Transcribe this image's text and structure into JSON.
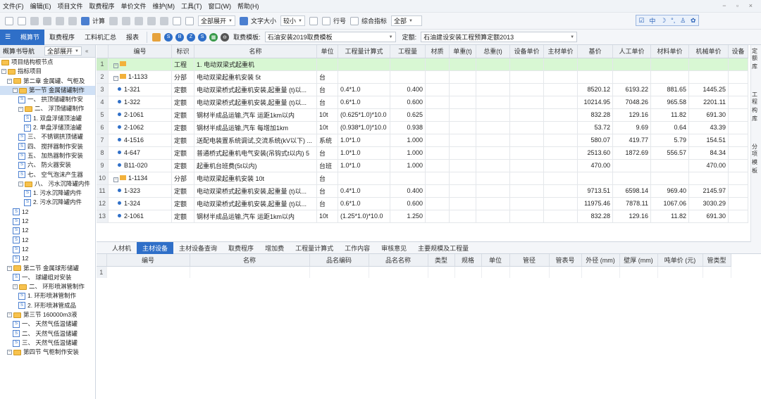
{
  "menu": [
    "文件(F)",
    "编辑(E)",
    "项目文件",
    "取费程序",
    "单价文件",
    "维护(M)",
    "工具(T)",
    "窗口(W)",
    "帮助(H)"
  ],
  "toolbar1": {
    "calc_label": "计算",
    "expand_select": "全部展开",
    "font_size_label": "文字大小",
    "font_size_value": "较小",
    "row_no_label": "行号",
    "composite_label": "综合指标",
    "composite_value": "全部"
  },
  "toolbar2": {
    "tabs": [
      "概算节",
      "取费程序",
      "工料机汇总",
      "报表"
    ],
    "fee_template_label": "取费模板:",
    "fee_template_value": "石油安装2019取费模板",
    "quota_label": "定额:",
    "quota_value": "石油建设安装工程预算定额2013"
  },
  "nav": {
    "title": "概算书导航",
    "expand": "全部展开",
    "tree": [
      {
        "level": 0,
        "icon": "folder",
        "toggle": "",
        "label": "项目结构根节点"
      },
      {
        "level": 0,
        "icon": "folder",
        "toggle": "⊟",
        "label": "指标项目"
      },
      {
        "level": 1,
        "icon": "folder",
        "toggle": "⊟",
        "label": "第二章 金属罐、气柜及"
      },
      {
        "level": 2,
        "icon": "folder",
        "toggle": "⊟",
        "label": "第一节 金属储罐制作",
        "selected": true
      },
      {
        "level": 3,
        "icon": "doc",
        "toggle": "",
        "label": "一、 拱顶储罐制作安"
      },
      {
        "level": 3,
        "icon": "folder",
        "toggle": "⊟",
        "label": "二、 浮顶储罐制作"
      },
      {
        "level": 4,
        "icon": "doc",
        "toggle": "",
        "label": "1. 双盘浮储顶油罐"
      },
      {
        "level": 4,
        "icon": "doc",
        "toggle": "",
        "label": "2. 单盘浮储顶油罐"
      },
      {
        "level": 3,
        "icon": "doc",
        "toggle": "",
        "label": "三、 不锈钢拱顶储罐"
      },
      {
        "level": 3,
        "icon": "doc",
        "toggle": "",
        "label": "四、 搅拌器制作安装"
      },
      {
        "level": 3,
        "icon": "doc",
        "toggle": "",
        "label": "五、 加热器制作安装"
      },
      {
        "level": 3,
        "icon": "doc",
        "toggle": "",
        "label": "六、 防火器安装"
      },
      {
        "level": 3,
        "icon": "doc",
        "toggle": "",
        "label": "七、 空气泡沫产生器"
      },
      {
        "level": 3,
        "icon": "folder",
        "toggle": "⊟",
        "label": "八、 污水沉降罐内件"
      },
      {
        "level": 4,
        "icon": "doc",
        "toggle": "",
        "label": "1. 污水沉降罐内件"
      },
      {
        "level": 4,
        "icon": "doc",
        "toggle": "",
        "label": "2. 污水沉降罐内件"
      },
      {
        "level": 2,
        "icon": "doc",
        "toggle": "",
        "label": "12"
      },
      {
        "level": 2,
        "icon": "doc",
        "toggle": "",
        "label": "12"
      },
      {
        "level": 2,
        "icon": "doc",
        "toggle": "",
        "label": "12"
      },
      {
        "level": 2,
        "icon": "doc",
        "toggle": "",
        "label": "12"
      },
      {
        "level": 2,
        "icon": "doc",
        "toggle": "",
        "label": "12"
      },
      {
        "level": 2,
        "icon": "doc",
        "toggle": "",
        "label": "12"
      },
      {
        "level": 1,
        "icon": "folder",
        "toggle": "⊟",
        "label": "第二节 金属球形储罐"
      },
      {
        "level": 2,
        "icon": "doc",
        "toggle": "",
        "label": "一、 球罐组对安装"
      },
      {
        "level": 2,
        "icon": "folder",
        "toggle": "⊟",
        "label": "二、 环形喷淋管制作"
      },
      {
        "level": 3,
        "icon": "doc",
        "toggle": "",
        "label": "1. 环形喷淋管制作"
      },
      {
        "level": 3,
        "icon": "doc",
        "toggle": "",
        "label": "2. 环形喷淋管成品"
      },
      {
        "level": 1,
        "icon": "folder",
        "toggle": "⊟",
        "label": "第三节 160000m3液"
      },
      {
        "level": 2,
        "icon": "doc",
        "toggle": "",
        "label": "一、 天然气低温储罐"
      },
      {
        "level": 2,
        "icon": "doc",
        "toggle": "",
        "label": "二、 天然气低温储罐"
      },
      {
        "level": 2,
        "icon": "doc",
        "toggle": "",
        "label": "三、 天然气低温储罐"
      },
      {
        "level": 1,
        "icon": "folder",
        "toggle": "⊟",
        "label": "第四节 气柜制作安装"
      }
    ]
  },
  "grid": {
    "columns": [
      "",
      "编号",
      "标识",
      "名称",
      "单位",
      "工程量计算式",
      "工程量",
      "材质",
      "单重(t)",
      "总重(t)",
      "设备单价",
      "主材单价",
      "基价",
      "人工单价",
      "材料单价",
      "机械单价",
      "设备"
    ],
    "rows": [
      {
        "n": "1",
        "type": "proj",
        "code": "",
        "flag": "工程",
        "name": "1. 电动双梁式起重机",
        "unit": "",
        "formula": "",
        "qty": "",
        "base": "",
        "labor": "",
        "mat": "",
        "mach": ""
      },
      {
        "n": "2",
        "type": "part",
        "code": "1-1133",
        "flag": "分部",
        "name": "电动双梁起重机安装 5t",
        "unit": "台",
        "formula": "",
        "qty": "",
        "base": "",
        "labor": "",
        "mat": "",
        "mach": ""
      },
      {
        "n": "3",
        "type": "item",
        "code": "1-321",
        "flag": "定额",
        "name": "电动双梁桥式起重机安装,起重量 (t)以...",
        "unit": "台",
        "formula": "0.4*1.0",
        "qty": "0.400",
        "base": "8520.12",
        "labor": "6193.22",
        "mat": "881.65",
        "mach": "1445.25"
      },
      {
        "n": "4",
        "type": "item",
        "code": "1-322",
        "flag": "定额",
        "name": "电动双梁桥式起重机安装,起重量 (t)以...",
        "unit": "台",
        "formula": "0.6*1.0",
        "qty": "0.600",
        "base": "10214.95",
        "labor": "7048.26",
        "mat": "965.58",
        "mach": "2201.11"
      },
      {
        "n": "5",
        "type": "item",
        "code": "2-1061",
        "flag": "定额",
        "name": "钢材半成品运输,汽车 运距1km以内",
        "unit": "10t",
        "formula": "(0.625*1.0)*10.0",
        "qty": "0.625",
        "base": "832.28",
        "labor": "129.16",
        "mat": "11.82",
        "mach": "691.30"
      },
      {
        "n": "6",
        "type": "item",
        "code": "2-1062",
        "flag": "定额",
        "name": "钢材半成品运输,汽车 每增加1km",
        "unit": "10t",
        "formula": "(0.938*1.0)*10.0",
        "qty": "0.938",
        "base": "53.72",
        "labor": "9.69",
        "mat": "0.64",
        "mach": "43.39"
      },
      {
        "n": "7",
        "type": "item",
        "code": "4-1516",
        "flag": "定额",
        "name": "送配电装置系统调试,交流系统(kV以下) ...",
        "unit": "系统",
        "formula": "1.0*1.0",
        "qty": "1.000",
        "base": "580.07",
        "labor": "419.77",
        "mat": "5.79",
        "mach": "154.51"
      },
      {
        "n": "8",
        "type": "item",
        "code": "4-647",
        "flag": "定额",
        "name": "普通桥式起重机电气安装(吊钩式t以内) 5",
        "unit": "台",
        "formula": "1.0*1.0",
        "qty": "1.000",
        "base": "2513.60",
        "labor": "1872.69",
        "mat": "556.57",
        "mach": "84.34"
      },
      {
        "n": "9",
        "type": "item",
        "code": "B11-020",
        "flag": "定额",
        "name": "起重机台班费(5t以内)",
        "unit": "台班",
        "formula": "1.0*1.0",
        "qty": "1.000",
        "base": "470.00",
        "labor": "",
        "mat": "",
        "mach": "470.00"
      },
      {
        "n": "10",
        "type": "part",
        "code": "1-1134",
        "flag": "分部",
        "name": "电动双梁起重机安装 10t",
        "unit": "台",
        "formula": "",
        "qty": "",
        "base": "",
        "labor": "",
        "mat": "",
        "mach": ""
      },
      {
        "n": "11",
        "type": "item",
        "code": "1-323",
        "flag": "定额",
        "name": "电动双梁桥式起重机安装,起重量 (t)以...",
        "unit": "台",
        "formula": "0.4*1.0",
        "qty": "0.400",
        "base": "9713.51",
        "labor": "6598.14",
        "mat": "969.40",
        "mach": "2145.97"
      },
      {
        "n": "12",
        "type": "item",
        "code": "1-324",
        "flag": "定额",
        "name": "电动双梁桥式起重机安装,起重量 (t)以...",
        "unit": "台",
        "formula": "0.6*1.0",
        "qty": "0.600",
        "base": "11975.46",
        "labor": "7878.11",
        "mat": "1067.06",
        "mach": "3030.29"
      },
      {
        "n": "13",
        "type": "item",
        "code": "2-1061",
        "flag": "定额",
        "name": "钢材半成品运输,汽车 运距1km以内",
        "unit": "10t",
        "formula": "(1.25*1.0)*10.0",
        "qty": "1.250",
        "base": "832.28",
        "labor": "129.16",
        "mat": "11.82",
        "mach": "691.30"
      }
    ]
  },
  "bottom": {
    "tabs": [
      "人材机",
      "主材设备",
      "主材设备查询",
      "取费程序",
      "增加费",
      "工程量计算式",
      "工作内容",
      "审核意见",
      "主要规模及工程量"
    ],
    "active_tab": "主材设备",
    "columns": [
      "",
      "编号",
      "名称",
      "品名编码",
      "品名名称",
      "类型",
      "规格",
      "单位",
      "管径",
      "管表号",
      "外径 (mm)",
      "壁厚 (mm)",
      "吨单价 (元)",
      "管类型"
    ],
    "rows": [
      [
        "1",
        "",
        "",
        "",
        "",
        "",
        "",
        "",
        "",
        "",
        "",
        "",
        "",
        ""
      ]
    ]
  },
  "right_col": [
    "定额",
    "库",
    "工程",
    "构",
    "库",
    "分项",
    "模",
    "板"
  ]
}
